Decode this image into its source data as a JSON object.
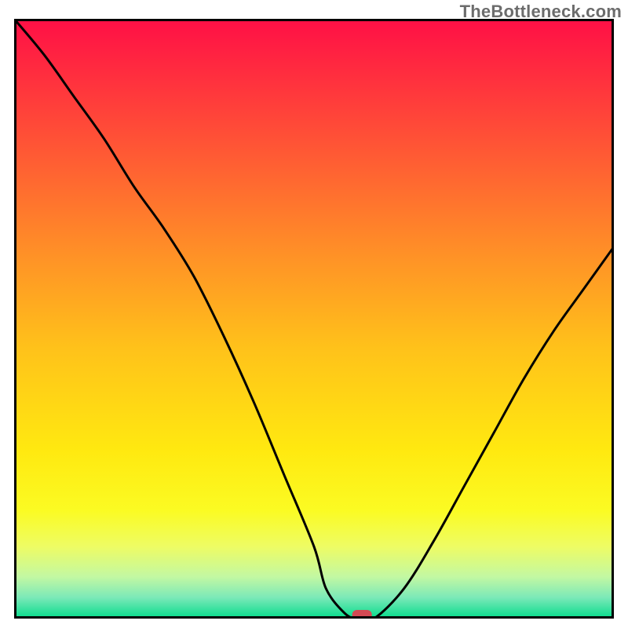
{
  "watermark": "TheBottleneck.com",
  "chart_data": {
    "type": "line",
    "title": "",
    "xlabel": "",
    "ylabel": "",
    "xlim": [
      0,
      100
    ],
    "ylim": [
      0,
      100
    ],
    "grid": false,
    "series": [
      {
        "name": "curve",
        "x": [
          0,
          5,
          10,
          15,
          20,
          25,
          30,
          35,
          40,
          45,
          50,
          52,
          55,
          57,
          60,
          65,
          70,
          75,
          80,
          85,
          90,
          95,
          100
        ],
        "values": [
          100,
          94,
          87,
          80,
          72,
          65,
          57,
          47,
          36,
          24,
          12,
          5,
          1,
          0,
          0,
          5,
          13,
          22,
          31,
          40,
          48,
          55,
          62
        ]
      }
    ],
    "marker": {
      "x": 58,
      "y": 0,
      "color": "#d44a54"
    },
    "background_gradient": {
      "stops": [
        {
          "offset": 0.0,
          "color": "#ff0f46"
        },
        {
          "offset": 0.2,
          "color": "#ff5136"
        },
        {
          "offset": 0.4,
          "color": "#ff9326"
        },
        {
          "offset": 0.55,
          "color": "#ffc21a"
        },
        {
          "offset": 0.72,
          "color": "#ffe910"
        },
        {
          "offset": 0.82,
          "color": "#fbfb23"
        },
        {
          "offset": 0.88,
          "color": "#eefc64"
        },
        {
          "offset": 0.93,
          "color": "#c3f8a2"
        },
        {
          "offset": 0.965,
          "color": "#7be9b8"
        },
        {
          "offset": 1.0,
          "color": "#05db8b"
        }
      ]
    },
    "border_color": "#000000"
  }
}
